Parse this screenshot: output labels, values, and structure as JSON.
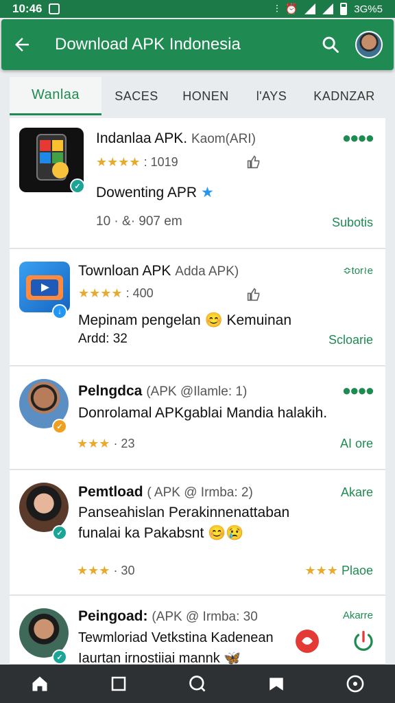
{
  "status_bar": {
    "time": "10:46",
    "network": "3G%5"
  },
  "app_bar": {
    "title": "Download APK Indonesia"
  },
  "tabs": [
    {
      "label": "Wanlaa",
      "active": true
    },
    {
      "label": "SACES",
      "active": false
    },
    {
      "label": "HONEN",
      "active": false
    },
    {
      "label": "l'AYS",
      "active": false
    },
    {
      "label": "KADNZAR",
      "active": false
    }
  ],
  "items": [
    {
      "title": "Indanlaa APK.",
      "subtitle": "Kaom(ARI)",
      "stars": "★★★★",
      "rating": ": 1019",
      "line1": "Dowenting APR",
      "meta": "10  ·  &·  907 em",
      "action": "Subotis"
    },
    {
      "title": "Townloan APK",
      "subtitle": "Adda APK)",
      "stars": "★★★★",
      "rating": ": 400",
      "line1": "Mepinam pengelan 😊 Kemuinan",
      "line2": "Ardd: 32",
      "action": "Scloarie"
    },
    {
      "title": "Pelngdca",
      "subtitle": "(APK @Ilamle: 1)",
      "line1": "Donrolamal APKgablai Mandia halakih.",
      "stars": "★★★",
      "rating": "· 23",
      "action": "AI ore"
    },
    {
      "title": "Pemtload",
      "subtitle": "( APK @ Irmba: 2)",
      "line1": "Panseahislan Perakinnenattaban",
      "line2": "funalai ka Pakabsnt 😊😢",
      "stars": "★★★",
      "rating": "· 30",
      "action_stars": "★★★",
      "action": "Plaoe",
      "top_action": "Akare"
    },
    {
      "title": "Peingoad:",
      "subtitle": "(APK @ Irmba: 30",
      "line1": "Tewmloriad Vetkstina Kadenean",
      "line2": "Iaurtan irnostiiai mannk 🦋",
      "top_action": "Akarre"
    }
  ],
  "colors": {
    "primary": "#1f8a52",
    "status_bar": "#1b7a47",
    "nav_bar": "#2e3133",
    "star": "#e9a92a"
  }
}
